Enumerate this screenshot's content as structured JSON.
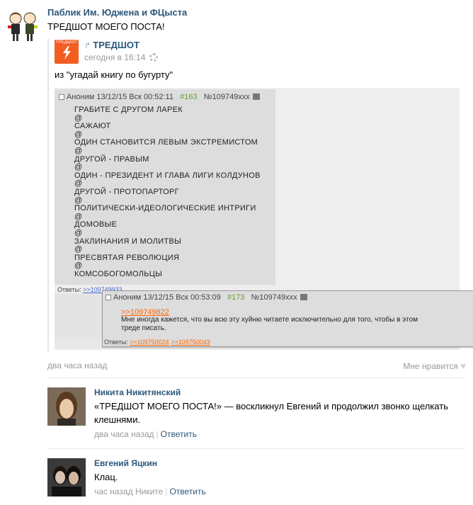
{
  "post": {
    "author": "Паблик Им. Юджена и ФЦыста",
    "text": "ТРЕДШОТ МОЕГО ПОСТА!",
    "time": "два часа назад",
    "like_label": "Мне нравится"
  },
  "repost": {
    "logo_text": "ТРЕДШОТ",
    "source": "ТРЕДШОТ",
    "time": "сегодня в 16:14",
    "text": "из \"угадай книгу по бугурту\""
  },
  "board": {
    "main_post": {
      "header_name": "Аноним",
      "header_date": "13/12/15 Вск 00:52:11",
      "header_num": "#163",
      "header_id": "№109749xxx",
      "lines": [
        "ГРАБИТЕ С ДРУГОМ ЛАРЕК",
        "@",
        "САЖАЮТ",
        "@",
        "ОДИН СТАНОВИТСЯ ЛЕВЫМ ЭКСТРЕМИСТОМ",
        "@",
        "ДРУГОЙ - ПРАВЫМ",
        "@",
        "ОДИН - ПРЕЗИДЕНТ И ГЛАВА ЛИГИ КОЛДУНОВ",
        "@",
        "ДРУГОЙ - ПРОТОПАРТОРГ",
        "@",
        "ПОЛИТИЧЕСКИ-ИДЕОЛОГИЧЕСКИЕ ИНТРИГИ",
        "@",
        "ДОМОВЫЕ",
        "@",
        "ЗАКЛИНАНИЯ И МОЛИТВЫ",
        "@",
        "ПРЕСВЯТАЯ РЕВОЛЮЦИЯ",
        "@",
        "КОМСОБОГОМОЛЬЦЫ"
      ],
      "replies_label": "Ответы:",
      "replies": [
        ">>109749933"
      ]
    },
    "popup_post": {
      "header_name": "Аноним",
      "header_date": "13/12/15 Вск 00:53:09",
      "header_num": "#173",
      "header_id": "№109749xxx",
      "quote": ">>109749822",
      "body": "Мне иногда кажется, что вы всю эту хуйню читаете исключительно для того, чтобы в этом треде писать.",
      "replies_label": "Ответы:",
      "replies": [
        ">>109750024",
        ">>109750043"
      ]
    }
  },
  "comments": [
    {
      "name": "Никита Никитянский",
      "text": "«ТРЕДШОТ МОЕГО ПОСТА!» — воскликнул Евгений и продолжил звонко щелкать клешнями.",
      "time": "два часа назад",
      "reply_to": "",
      "action": "Ответить"
    },
    {
      "name": "Евгений Яцкин",
      "text": "Клац.",
      "time": "час назад",
      "reply_to": "Никите",
      "action": "Ответить"
    }
  ],
  "colors": {
    "link": "#2b587a",
    "meta": "#999999",
    "logo": "#f25d22",
    "board_num": "#6b9e2f",
    "board_reply": "#ff6600"
  }
}
